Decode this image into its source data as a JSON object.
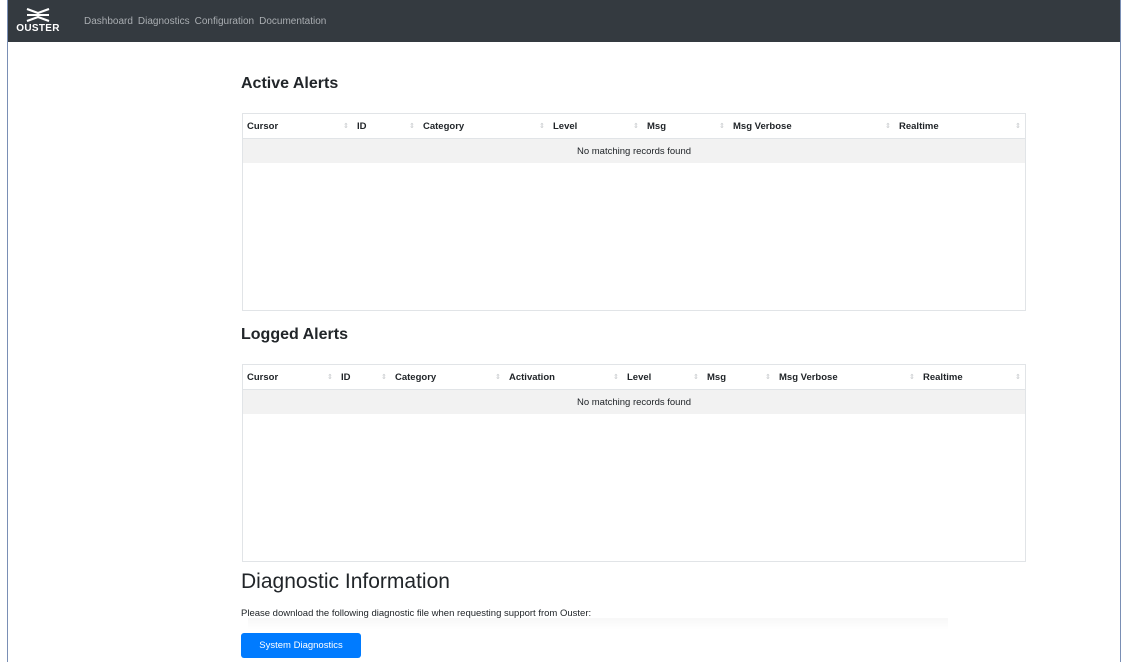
{
  "navbar": {
    "brand": "OUSTER",
    "links": [
      "Dashboard",
      "Diagnostics",
      "Configuration",
      "Documentation"
    ]
  },
  "active_alerts": {
    "title": "Active Alerts",
    "columns": [
      "Cursor",
      "ID",
      "Category",
      "Level",
      "Msg",
      "Msg Verbose",
      "Realtime"
    ],
    "empty_message": "No matching records found"
  },
  "logged_alerts": {
    "title": "Logged Alerts",
    "columns": [
      "Cursor",
      "ID",
      "Category",
      "Activation",
      "Level",
      "Msg",
      "Msg Verbose",
      "Realtime"
    ],
    "empty_message": "No matching records found"
  },
  "diagnostics": {
    "title": "Diagnostic Information",
    "description": "Please download the following diagnostic file when requesting support from Ouster:",
    "button_label": "System Diagnostics"
  },
  "colors": {
    "navbar_bg": "#343a40",
    "nav_link": "#a9adb1",
    "button_bg": "#007bff",
    "empty_row_bg": "#f2f2f2"
  }
}
